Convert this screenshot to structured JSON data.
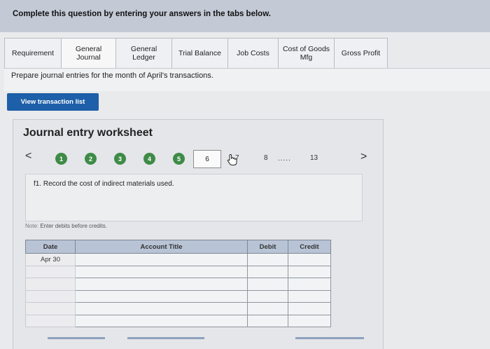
{
  "header": {
    "instruction": "Complete this question by entering your answers in the tabs below."
  },
  "tabs": [
    {
      "label": "Requirement"
    },
    {
      "label": "General\nJournal"
    },
    {
      "label": "General\nLedger"
    },
    {
      "label": "Trial Balance"
    },
    {
      "label": "Job Costs"
    },
    {
      "label": "Cost of Goods\nMfg"
    },
    {
      "label": "Gross Profit"
    }
  ],
  "prompt": "Prepare journal entries for the month of April's transactions.",
  "view_button": "View transaction list",
  "worksheet": {
    "title": "Journal entry worksheet",
    "prev": "<",
    "next": ">",
    "steps": [
      "1",
      "2",
      "3",
      "4",
      "5",
      "6",
      "7",
      "8",
      "13"
    ],
    "ellipsis": ".....",
    "instruction": "f1. Record the cost of indirect materials used.",
    "note_label": "Note:",
    "note_text": " Enter debits before credits."
  },
  "table": {
    "headers": {
      "date": "Date",
      "account": "Account Title",
      "debit": "Debit",
      "credit": "Credit"
    },
    "rows": [
      {
        "date": "Apr 30"
      },
      {
        "date": ""
      },
      {
        "date": ""
      },
      {
        "date": ""
      },
      {
        "date": ""
      },
      {
        "date": ""
      }
    ]
  },
  "colors": {
    "button": "#1d5fa8",
    "step_done": "#3e8b47",
    "banner": "#c3cad6",
    "header_row": "#b8c4d6"
  },
  "icons": {
    "cursor": "hand-pointer-icon"
  }
}
